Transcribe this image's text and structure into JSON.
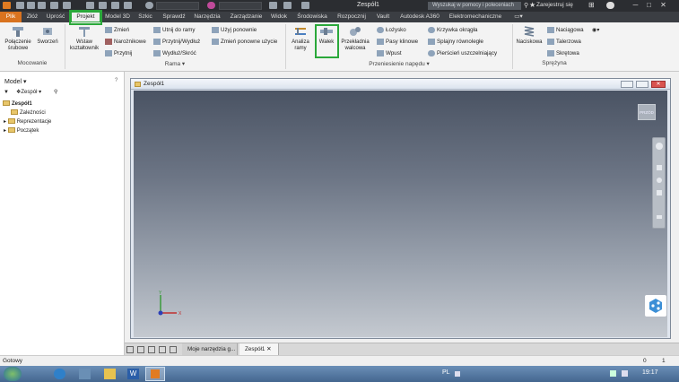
{
  "titlebar": {
    "title": "Zespół1",
    "search_placeholder": "Wyszukaj w pomocy i poleceniach",
    "signin": "Zarejestruj się",
    "minimize": "─",
    "maximize": "□",
    "close": "✕"
  },
  "tabs": [
    "Plik",
    "Złóż",
    "Uprość",
    "Projekt",
    "Model 3D",
    "Szkic",
    "Sprawdź",
    "Narzędzia",
    "Zarządzanie",
    "Widok",
    "Środowiska",
    "Rozpocznij",
    "Vault",
    "Autodesk A360",
    "Elektromechaniczne"
  ],
  "ribbon": {
    "mocowanie": {
      "polaczenie": "Połączenie śrubowe",
      "sworzen": "Sworzeń",
      "group": "Mocowanie"
    },
    "rama": {
      "wstaw": "Wstaw kształtownik",
      "zmien": "Zmień",
      "narozniki": "Narożnikowe",
      "przytnij": "Przytnij",
      "utnij": "Utnij do ramy",
      "przytnij_wydluz": "Przytnij/Wydłuż",
      "wydluz_skroc": "Wydłuż/Skróć",
      "uzyj": "Użyj ponownie",
      "zmien_ponowne": "Zmień ponowne użycie",
      "group": "Rama"
    },
    "naped": {
      "analiza": "Analiza ramy",
      "walek": "Wałek",
      "przekladnia": "Przekładnia walcowa",
      "lozysko": "Łożysko",
      "pasy": "Pasy klinowe",
      "wpust": "Wpust",
      "krzywka": "Krzywka okrągła",
      "splajny": "Splajny równoległe",
      "pierscien": "Pierścień uszczelniający",
      "group": "Przeniesienie napędu"
    },
    "sprezyna": {
      "naciskowa": "Naciskowa",
      "naciagowa": "Naciągowa",
      "talerzowa": "Talerzowa",
      "skretowa": "Skrętowa",
      "group": "Sprężyna"
    }
  },
  "leftpanel": {
    "header": "Model",
    "dropdown": "Zespół",
    "tree": [
      "Zespół1",
      "Zależności",
      "Reprezentacje",
      "Początek"
    ]
  },
  "document": {
    "title": "Zespół1",
    "viewcube": "PRZÓD"
  },
  "doctabs": [
    "Moje narzędzia g...",
    "Zespół1"
  ],
  "status": {
    "text": "Gotowy",
    "count1": "0",
    "count2": "1"
  },
  "taskbar": {
    "lang": "PL",
    "time": "19:17"
  },
  "colors": {
    "accent_orange": "#d9731f",
    "highlight_green": "#2aa83a",
    "titlebar_dark": "#2b2d31"
  }
}
